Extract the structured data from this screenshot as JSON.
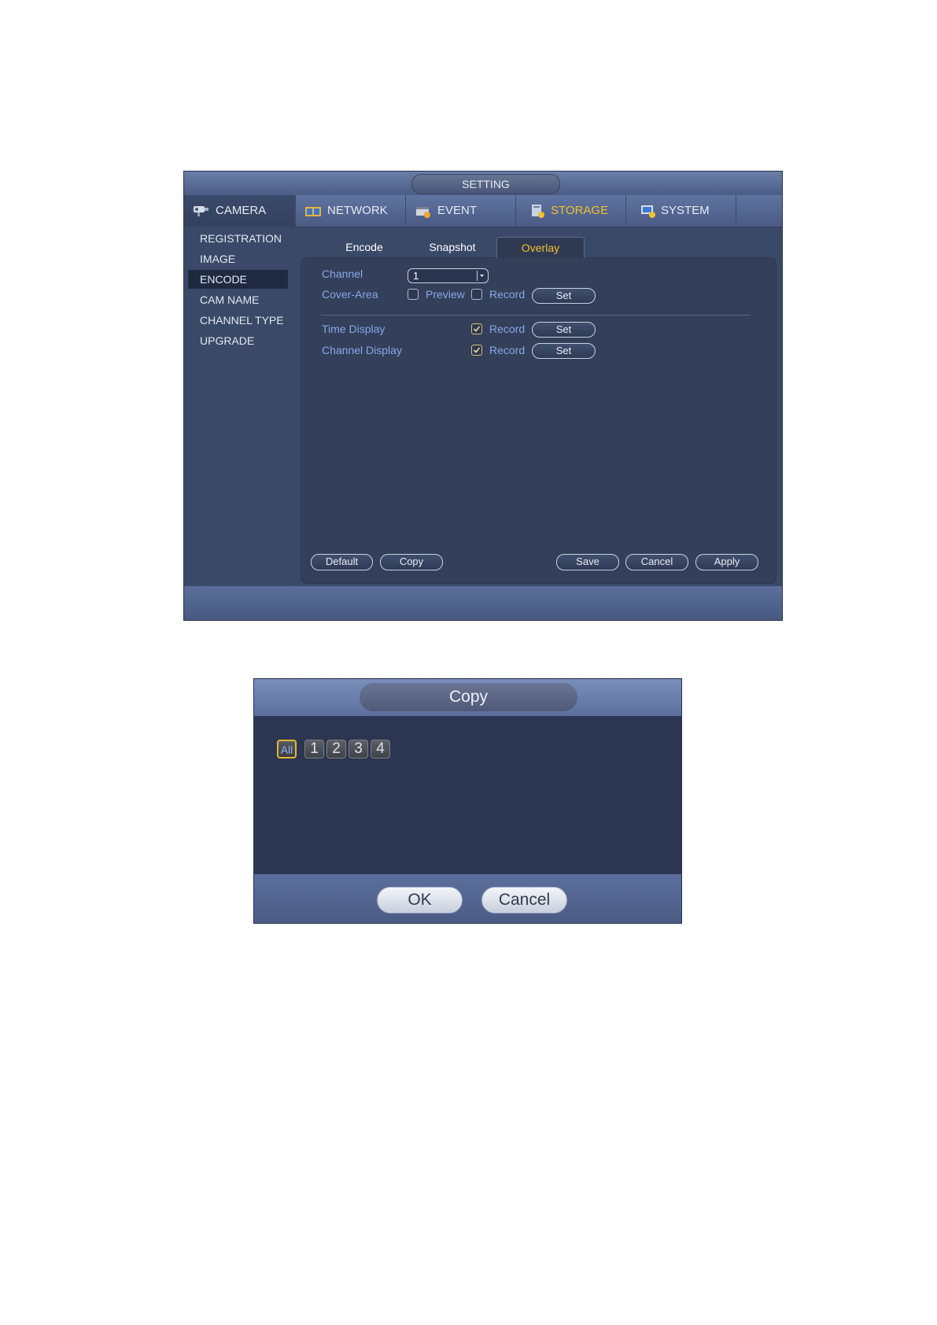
{
  "setting_window": {
    "title": "SETTING",
    "nav_tabs": [
      {
        "label": "CAMERA",
        "icon": "camera-icon"
      },
      {
        "label": "NETWORK",
        "icon": "network-icon"
      },
      {
        "label": "EVENT",
        "icon": "event-icon"
      },
      {
        "label": "STORAGE",
        "icon": "storage-icon"
      },
      {
        "label": "SYSTEM",
        "icon": "system-icon"
      }
    ],
    "left_menu": [
      "REGISTRATION",
      "IMAGE",
      "ENCODE",
      "CAM NAME",
      "CHANNEL TYPE",
      "UPGRADE"
    ],
    "active_menu": "ENCODE",
    "sub_tabs": [
      "Encode",
      "Snapshot",
      "Overlay"
    ],
    "active_sub_tab": "Overlay",
    "overlay": {
      "channel_label": "Channel",
      "channel_value": "1",
      "cover_area_label": "Cover-Area",
      "preview_label": "Preview",
      "record_label": "Record",
      "set_label": "Set",
      "time_display_label": "Time Display",
      "channel_display_label": "Channel Display",
      "cover_area_preview_checked": false,
      "cover_area_record_checked": false,
      "time_display_record_checked": true,
      "channel_display_record_checked": true
    },
    "footer_buttons": {
      "default": "Default",
      "copy": "Copy",
      "save": "Save",
      "cancel": "Cancel",
      "apply": "Apply"
    },
    "colors": {
      "accent": "#f2c12e",
      "label": "#86a8ea",
      "panel": "#343f59"
    }
  },
  "copy_dialog": {
    "title": "Copy",
    "channels": [
      "All",
      "1",
      "2",
      "3",
      "4"
    ],
    "selected": "All",
    "ok_label": "OK",
    "cancel_label": "Cancel"
  }
}
